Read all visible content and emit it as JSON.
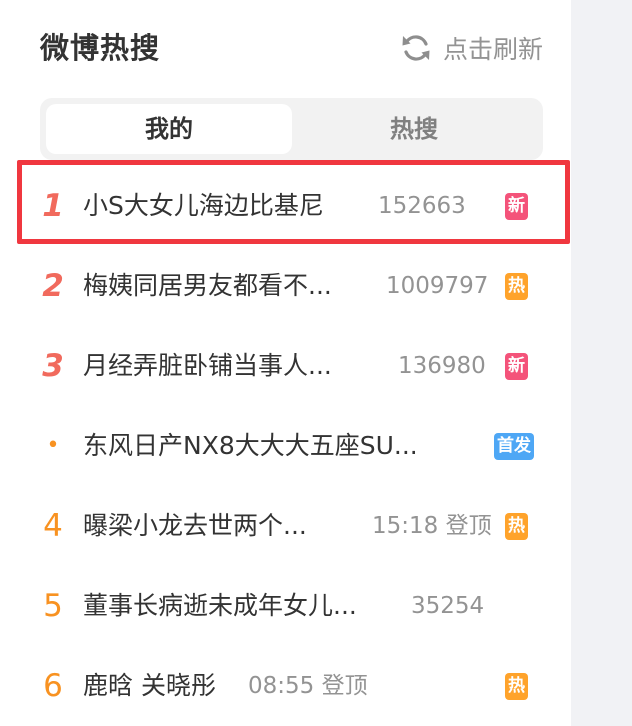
{
  "header": {
    "title": "微博热搜",
    "refresh_label": "点击刷新"
  },
  "tabs": [
    {
      "label": "我的",
      "active": true
    },
    {
      "label": "热搜",
      "active": false
    }
  ],
  "items": [
    {
      "rank": "1",
      "text": "小S大女儿海边比基尼",
      "meta": "152663",
      "badge": "新",
      "badge_color": "#f4537a",
      "highlighted": true
    },
    {
      "rank": "2",
      "text": "梅姨同居男友都看不...",
      "meta": "1009797",
      "badge": "热",
      "badge_color": "#ffa32b"
    },
    {
      "rank": "3",
      "text": "月经弄脏卧铺当事人...",
      "meta": "136980",
      "badge": "新",
      "badge_color": "#f4537a"
    },
    {
      "rank": "•",
      "text": "东风日产NX8大大大五座SU...",
      "meta": "",
      "badge": "首发",
      "badge_color": "#4ea7f5"
    },
    {
      "rank": "4",
      "text": "曝梁小龙去世两个...",
      "meta": "15:18 登顶",
      "badge": "热",
      "badge_color": "#ffa32b"
    },
    {
      "rank": "5",
      "text": "董事长病逝未成年女儿...",
      "meta": "35254",
      "badge": "",
      "badge_color": ""
    },
    {
      "rank": "6",
      "text": "鹿晗 关晓彤",
      "meta": "08:55 登顶",
      "badge": "热",
      "badge_color": "#ffa32b"
    }
  ],
  "colors": {
    "top_rank": "#f16a5d",
    "rank": "#f89221",
    "highlight_border": "#f0373f"
  }
}
